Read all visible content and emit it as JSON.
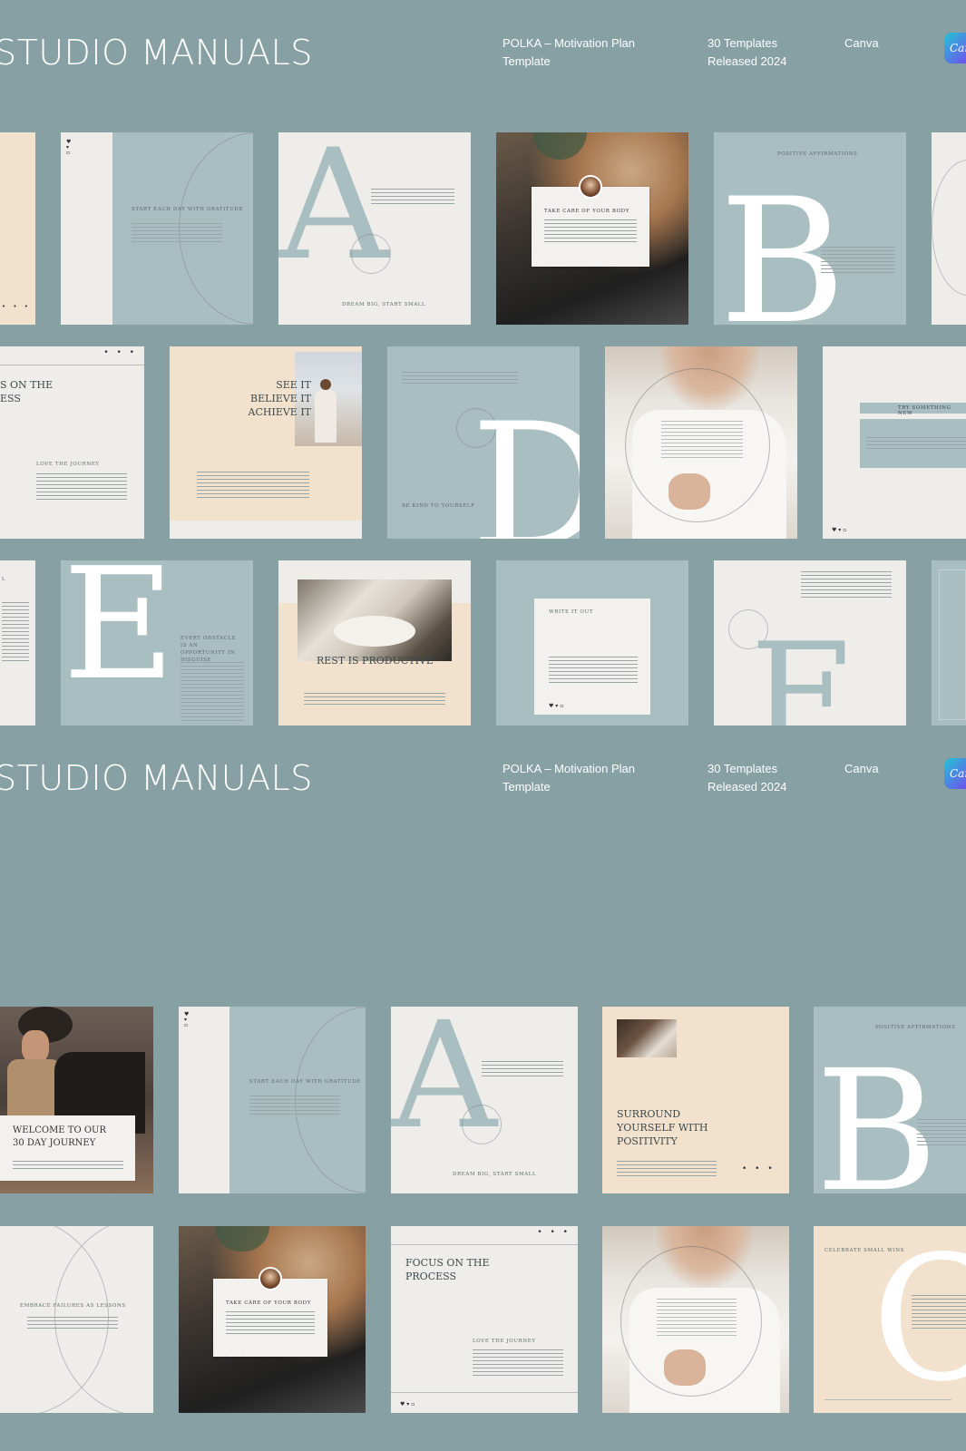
{
  "header": {
    "brand": "STUDIO MANUALS",
    "product": "POLKA – Motivation Plan",
    "product_line2": "Template",
    "count": "30 Templates",
    "released": "Released 2024",
    "platform": "Canva",
    "badge": "Canva"
  },
  "tiles": {
    "gratitude": "START EACH DAY WITH GRATITUDE",
    "dream": "DREAM BIG, START SMALL",
    "letter_a": "A",
    "take_care": "TAKE CARE OF YOUR BODY",
    "affirmations": "POSITIVE AFFIRMATIONS",
    "letter_b": "B",
    "on_the": "S ON THE",
    "ess": "ESS",
    "love_journey": "LOVE THE JOURNEY",
    "see_it": "SEE IT",
    "believe_it": "BELIEVE IT",
    "achieve_it": "ACHIEVE IT",
    "be_kind": "BE KIND TO YOURSELF",
    "letter_d": "D",
    "try_new": "TRY SOMETHING NEW",
    "letter_e": "E",
    "obstacle": "EVERY OBSTACLE IS AN OPPORTUNITY IN DISGUISE",
    "rest": "REST IS PRODUCTIVE",
    "write_out": "WRITE IT OUT",
    "letter_f": "F",
    "welcome": "WELCOME TO OUR",
    "welcome2": "30 DAY JOURNEY",
    "surround1": "SURROUND",
    "surround2": "YOURSELF WITH",
    "surround3": "POSITIVITY",
    "embrace": "EMBRACE FAILURES AS LESSONS",
    "focus1": "FOCUS ON THE",
    "focus2": "PROCESS",
    "celebrate": "CELEBRATE SMALL WINS",
    "letter_c": "C",
    "dots": "• • •"
  },
  "colors": {
    "background": "#87a0a4",
    "cream": "#efede9",
    "blue": "#a9bec1",
    "peach": "#f2e1cc"
  }
}
